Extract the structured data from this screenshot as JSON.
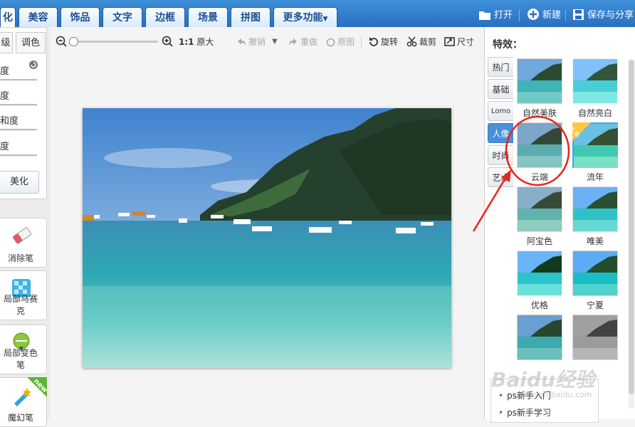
{
  "tabs": [
    {
      "label": "化",
      "active": true
    },
    {
      "label": "美容",
      "active": false
    },
    {
      "label": "饰品",
      "active": false
    },
    {
      "label": "文字",
      "active": false
    },
    {
      "label": "边框",
      "active": false
    },
    {
      "label": "场景",
      "active": false
    },
    {
      "label": "拼图",
      "active": false
    },
    {
      "label": "更多功能",
      "active": false
    }
  ],
  "top_actions": {
    "open": "打开",
    "new": "新建",
    "save": "保存与分享"
  },
  "left": {
    "tabs": [
      "级",
      "调色"
    ],
    "sliders": [
      "度",
      "度",
      "和度",
      "度"
    ],
    "beautify_button": "美化",
    "tools": [
      {
        "label": "消除笔",
        "icon": "eraser-icon"
      },
      {
        "label": "局部马赛克",
        "icon": "mosaic-icon"
      },
      {
        "label": "局部变色笔",
        "icon": "color-pen-icon"
      },
      {
        "label": "魔幻笔",
        "icon": "magic-pen-icon",
        "badge": "new"
      }
    ]
  },
  "toolbar": {
    "zoom_ratio": "1:1",
    "original_size": "原大",
    "undo": "撤销",
    "redo": "重做",
    "original": "原图",
    "rotate": "旋转",
    "crop": "裁剪",
    "size": "尺寸"
  },
  "effects": {
    "title": "特效：",
    "categories": [
      {
        "label": "热门",
        "active": false
      },
      {
        "label": "基础",
        "active": false
      },
      {
        "label": "Lomo",
        "active": false
      },
      {
        "label": "人像",
        "active": true
      },
      {
        "label": "时尚",
        "active": false
      },
      {
        "label": "艺术",
        "active": false
      }
    ],
    "items": [
      {
        "label": "自然美肤",
        "selected": false,
        "vip": false
      },
      {
        "label": "自然亮白",
        "selected": false,
        "vip": false
      },
      {
        "label": "云端",
        "selected": false,
        "vip": false
      },
      {
        "label": "流年",
        "selected": true,
        "vip": true
      },
      {
        "label": "阿宝色",
        "selected": false,
        "vip": false
      },
      {
        "label": "唯美",
        "selected": false,
        "vip": false
      },
      {
        "label": "优格",
        "selected": false,
        "vip": false
      },
      {
        "label": "宁夏",
        "selected": false,
        "vip": false
      },
      {
        "label": "",
        "selected": false,
        "vip": false
      },
      {
        "label": "",
        "selected": false,
        "vip": false
      }
    ],
    "vip_badge": "会员"
  },
  "help_links": [
    "ps新手入门",
    "ps新手学习"
  ],
  "watermark": {
    "text": "Baidu经验",
    "url": "jingyan.baidu.com"
  },
  "colors": {
    "accent": "#2a6fc0",
    "annotation": "#e8241c"
  }
}
